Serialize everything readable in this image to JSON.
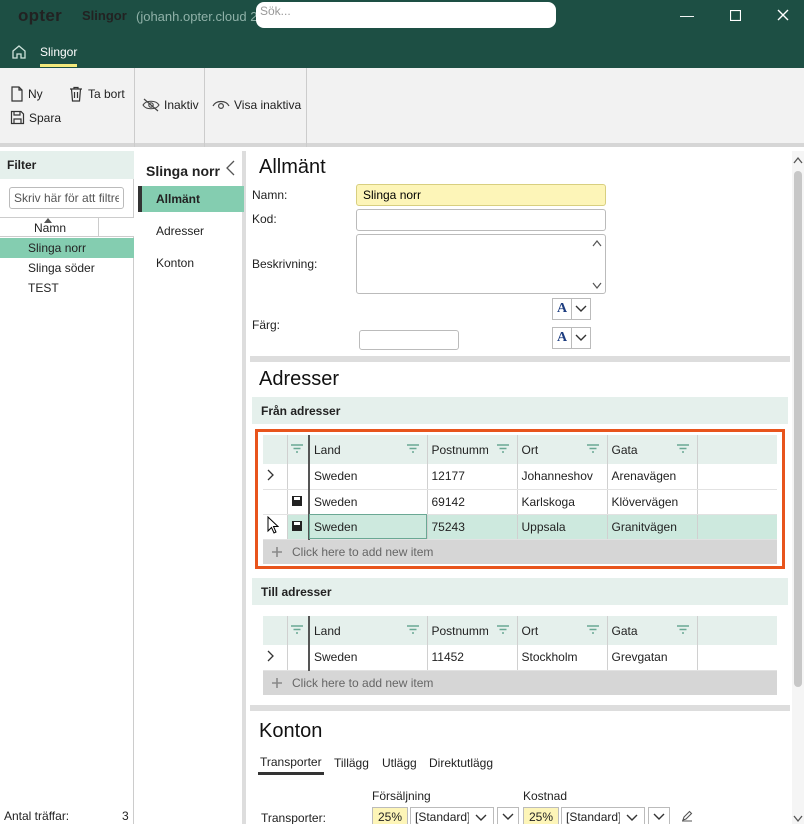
{
  "titlebar": {
    "logo": "opter",
    "app": "Slingor",
    "server": "(johanh.opter.cloud 2",
    "search_placeholder": "Sök..."
  },
  "tabbar": {
    "tab": "Slingor"
  },
  "ribbon": {
    "new": "Ny",
    "delete": "Ta bort",
    "save": "Spara",
    "inactive": "Inaktiv",
    "show_inactive": "Visa inaktiva"
  },
  "filter": {
    "title": "Filter",
    "placeholder": "Skriv här för att filtrera",
    "column": "Namn",
    "items": [
      "Slinga norr",
      "Slinga söder",
      "TEST"
    ],
    "count_label": "Antal träffar:",
    "count": "3"
  },
  "nav": {
    "title": "Slinga norr",
    "items": [
      "Allmänt",
      "Adresser",
      "Konton"
    ]
  },
  "general": {
    "title": "Allmänt",
    "name_label": "Namn:",
    "name_value": "Slinga norr",
    "code_label": "Kod:",
    "code_value": "",
    "desc_label": "Beskrivning:",
    "color_label": "Färg:",
    "font_glyph": "A"
  },
  "addresses": {
    "title": "Adresser",
    "from_title": "Från adresser",
    "to_title": "Till adresser",
    "columns": [
      "Land",
      "Postnummer",
      "Ort",
      "Gata"
    ],
    "from_rows": [
      {
        "land": "Sweden",
        "postnr": "12177",
        "ort": "Johanneshov",
        "gata": "Arenavägen"
      },
      {
        "land": "Sweden",
        "postnr": "69142",
        "ort": "Karlskoga",
        "gata": "Klövervägen"
      },
      {
        "land": "Sweden",
        "postnr": "75243",
        "ort": "Uppsala",
        "gata": "Granitvägen"
      }
    ],
    "to_rows": [
      {
        "land": "Sweden",
        "postnr": "11452",
        "ort": "Stockholm",
        "gata": "Grevgatan"
      }
    ],
    "add_new": "Click here to add new item"
  },
  "accounts": {
    "title": "Konton",
    "tabs": [
      "Transporter",
      "Tillägg",
      "Utlägg",
      "Direktutlägg"
    ],
    "sales_label": "Försäljning",
    "cost_label": "Kostnad",
    "row_label": "Transporter:",
    "sales_pct": "25%",
    "sales_select": "[Standard]",
    "cost_pct": "25%",
    "cost_select": "[Standard]"
  },
  "colors": {
    "header": "#1d4f44",
    "accent": "#84cdb0",
    "highlight": "#e8541c",
    "yellow": "#fdf5b8"
  }
}
